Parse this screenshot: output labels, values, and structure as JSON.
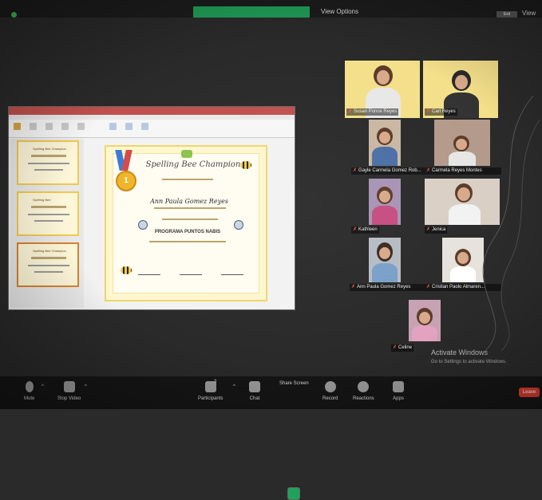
{
  "top": {
    "view_options": "View Options",
    "view_label": "View",
    "exit_label": "Exit"
  },
  "slide": {
    "title": "Spelling Bee Champion",
    "name": "Ann Paula Gomez Reyes",
    "program": "PROGRAMA PUNTOS NABIS",
    "thumb_labels": [
      "Spelling Bee Champion",
      "Spelling Bee",
      "Spelling Bee Champion"
    ]
  },
  "participants": [
    {
      "name": "Susan Ponce Reyes"
    },
    {
      "name": "Carl Reyes"
    },
    {
      "name": "Gayle Carmela Gomez Rob..."
    },
    {
      "name": "Carmela Reyes Montes"
    },
    {
      "name": "Kathleen"
    },
    {
      "name": "Jenica"
    },
    {
      "name": "Ann Paula Gomez Reyes"
    },
    {
      "name": "Cristian Paolo Almaren..."
    },
    {
      "name": "Celine"
    }
  ],
  "watermark": {
    "line1": "Activate Windows",
    "line2": "Go to Settings to activate Windows."
  },
  "toolbar": {
    "mute": "Mute",
    "stop_video": "Stop Video",
    "participants": "Participants",
    "participants_count": "3",
    "chat": "Chat",
    "share_screen": "Share Screen",
    "record": "Record",
    "reactions": "Reactions",
    "apps": "Apps",
    "leave": "Leave"
  },
  "colors": {
    "share_indicator": "#1f9e57",
    "leave": "#d63b2e",
    "tile_yellow": "#f4e08a"
  }
}
